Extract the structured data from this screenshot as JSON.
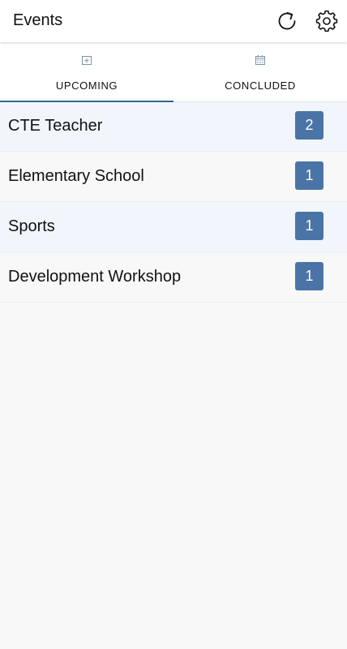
{
  "header": {
    "title": "Events",
    "refresh_icon": "refresh-icon",
    "settings_icon": "gear-icon"
  },
  "tabs": [
    {
      "label": "UPCOMING",
      "icon": "calendar-plus-icon",
      "selected": true
    },
    {
      "label": "CONCLUDED",
      "icon": "calendar-grid-icon",
      "selected": false
    }
  ],
  "events": [
    {
      "name": "CTE Teacher",
      "count": "2"
    },
    {
      "name": "Elementary School",
      "count": "1"
    },
    {
      "name": "Sports",
      "count": "1"
    },
    {
      "name": "Development Workshop",
      "count": "1"
    }
  ],
  "colors": {
    "badge": "#4a74a6",
    "tab_indicator": "#2f6a8c",
    "row_alt": "#f1f6fd",
    "background": "#f8f8f8"
  }
}
